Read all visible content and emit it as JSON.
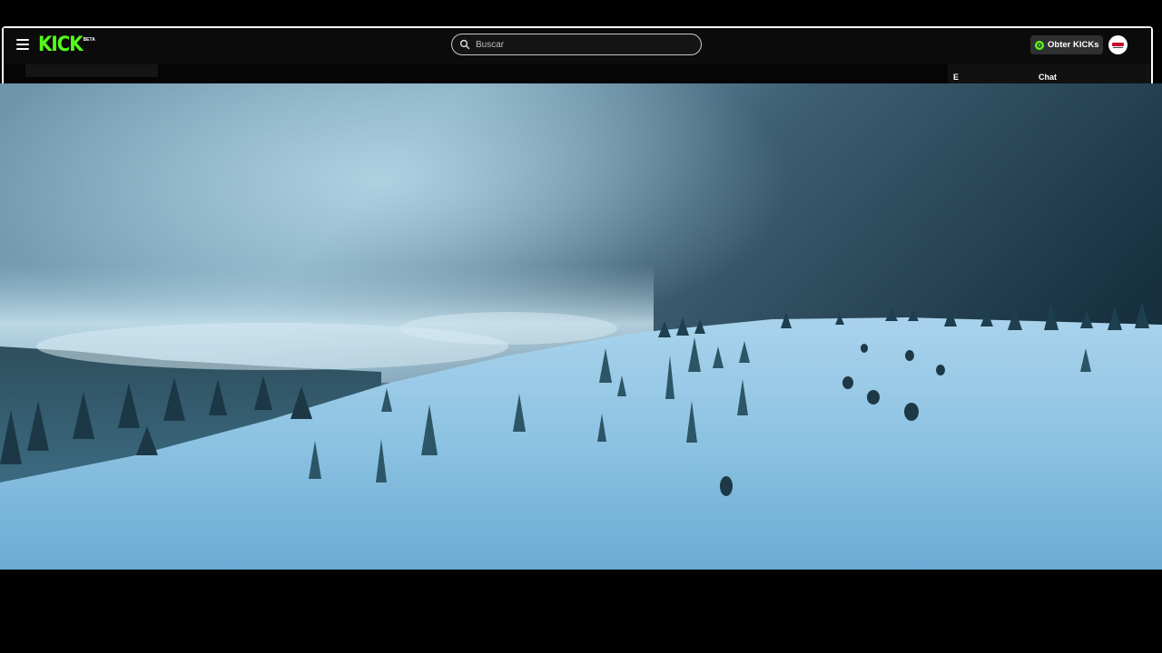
{
  "header": {
    "logo_text": "KICK",
    "logo_badge": "BETA",
    "search": {
      "placeholder": "Buscar",
      "value": ""
    },
    "kicks_button_label": "Obter KICKs",
    "menu_icon": "hamburger-menu-icon",
    "search_icon": "search-icon",
    "kicks_icon": "kicks-coin-icon",
    "brand_color": "#53fc18"
  },
  "subbar": {
    "tab_1": "E",
    "tab_2": "Chat"
  },
  "video": {
    "description_icon": "video-player",
    "content": "snowy-mountain-landscape"
  }
}
